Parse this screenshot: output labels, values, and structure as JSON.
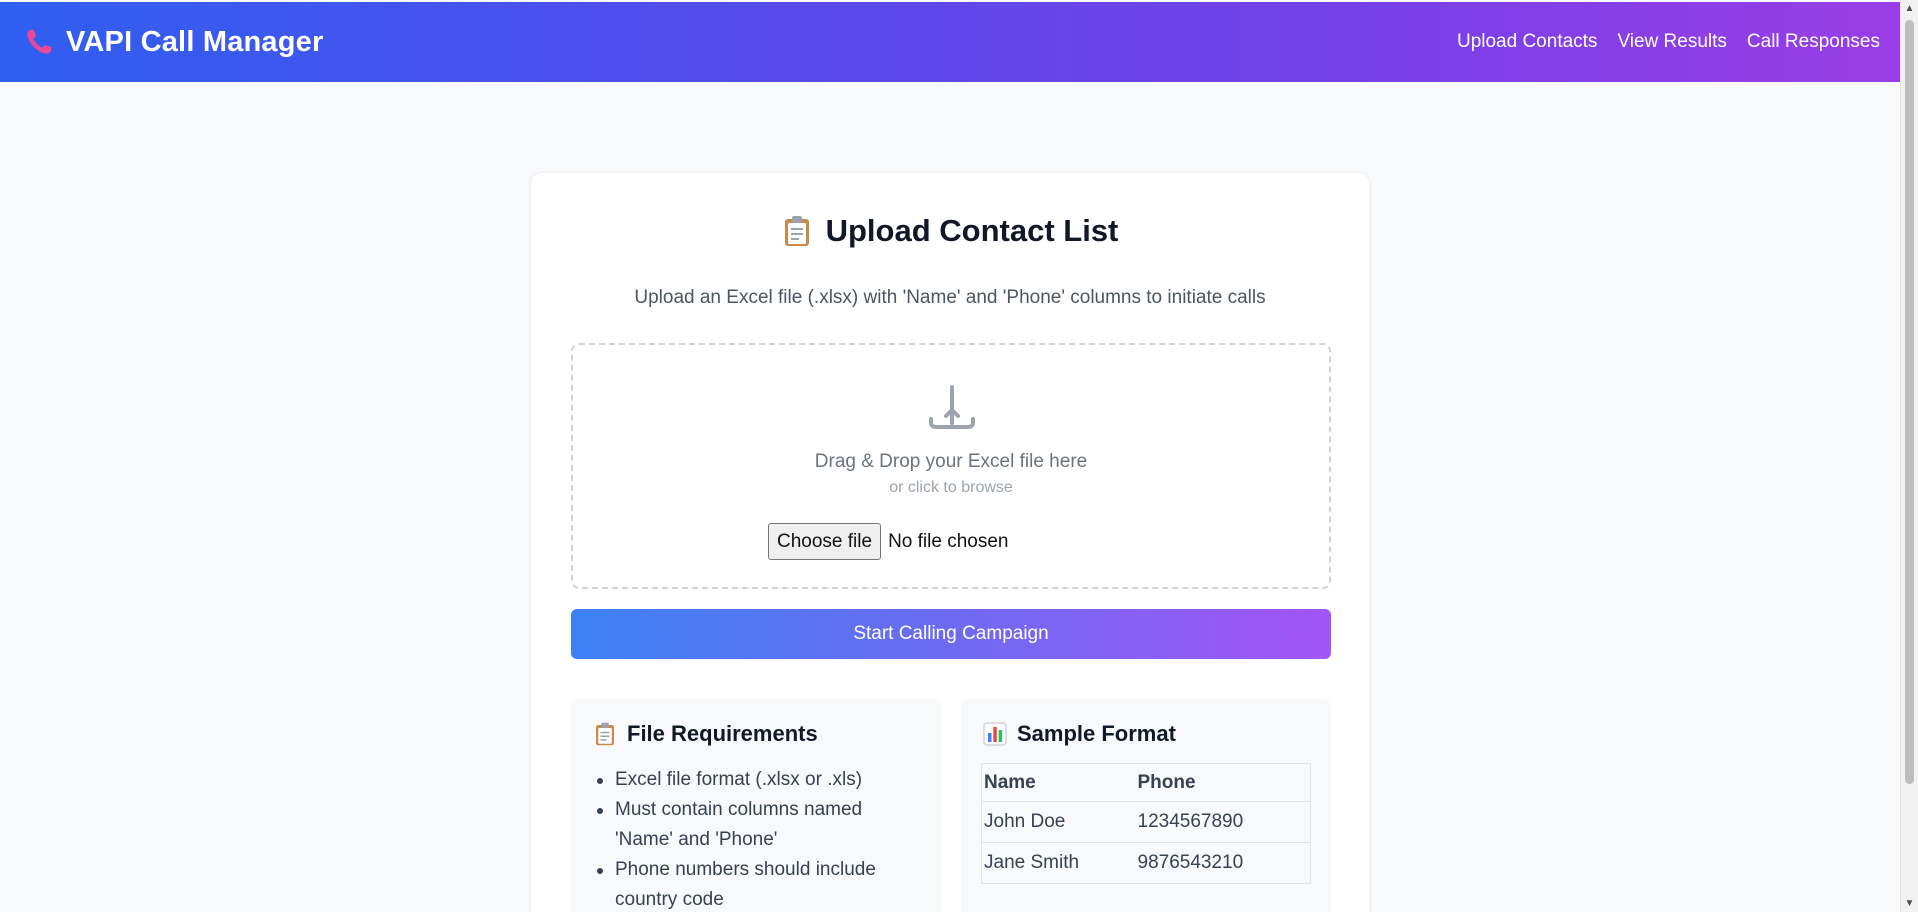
{
  "header": {
    "title": "VAPI Call Manager",
    "icon": "phone-icon",
    "nav": [
      {
        "label": "Upload Contacts"
      },
      {
        "label": "View Results"
      },
      {
        "label": "Call Responses"
      }
    ]
  },
  "upload_card": {
    "title": "Upload Contact List",
    "title_icon": "clipboard-icon",
    "subtitle": "Upload an Excel file (.xlsx) with 'Name' and 'Phone' columns to initiate calls",
    "dropzone": {
      "icon": "upload-icon",
      "primary": "Drag & Drop your Excel file here",
      "secondary": "or click to browse",
      "choose_label": "Choose file",
      "file_status": "No file chosen"
    },
    "start_button": "Start Calling Campaign"
  },
  "requirements": {
    "title": "File Requirements",
    "icon": "clipboard-icon",
    "items": [
      "Excel file format (.xlsx or .xls)",
      "Must contain columns named 'Name' and 'Phone'",
      "Phone numbers should include country code"
    ]
  },
  "sample": {
    "title": "Sample Format",
    "icon": "bar-chart-icon",
    "columns": [
      "Name",
      "Phone"
    ],
    "rows": [
      [
        "John Doe",
        "1234567890"
      ],
      [
        "Jane Smith",
        "9876543210"
      ]
    ]
  },
  "colors": {
    "header_gradient_start": "#2f5ff0",
    "header_gradient_end": "#9a3ee6",
    "button_gradient_start": "#3b82f6",
    "button_gradient_end": "#a355f7",
    "phone_icon": "#ec4899"
  }
}
